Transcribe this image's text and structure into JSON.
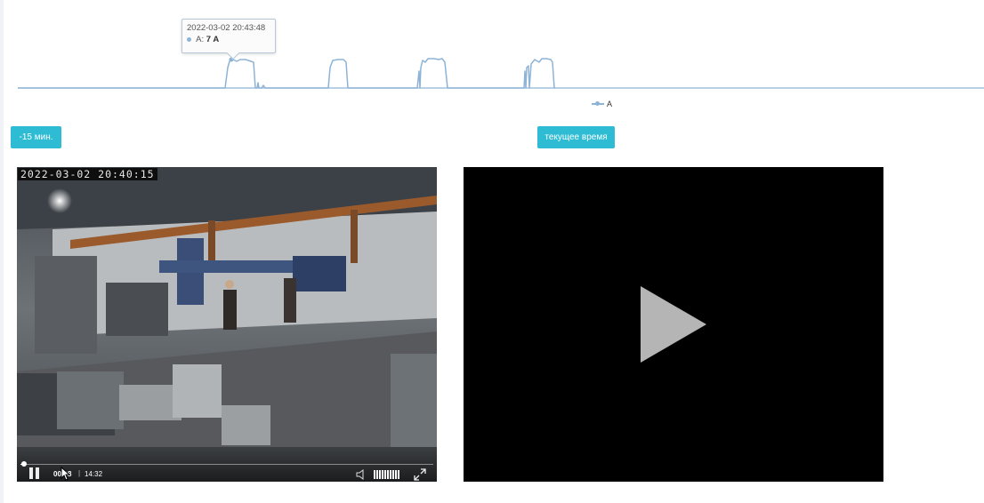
{
  "chart": {
    "series_name": "A",
    "line_color": "#8db3d6",
    "tooltip": {
      "time": "2022-03-02 20:43:48",
      "series": "A:",
      "value": "7 A"
    }
  },
  "controls": {
    "back_label": "-15 мин.",
    "now_label": "текущее время",
    "button_color": "#2dbcd4"
  },
  "video_left": {
    "timestamp": "2022-03-02  20:40:15",
    "current_time": "00:08",
    "separator": "|",
    "duration": "14:32",
    "progress": 0.009
  },
  "video_right": {
    "state": "paused",
    "icon": "play-icon"
  }
}
